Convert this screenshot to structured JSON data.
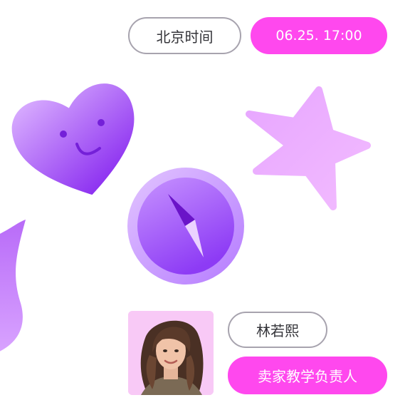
{
  "header": {
    "time_label": "北京时间",
    "time_value": "06.25. 17:00"
  },
  "presenter": {
    "name": "林若熙",
    "role": "卖家教学负责人"
  },
  "colors": {
    "accent": "#ff48ee",
    "outline": "#a7a3ae",
    "purple_dark": "#8a2cf0",
    "purple_light": "#d4a6ff",
    "avatar_bg": "#f8c9f6"
  },
  "icons": [
    "heart-smile-icon",
    "star-icon",
    "compass-icon",
    "flame-wave-icon",
    "presenter-avatar"
  ]
}
